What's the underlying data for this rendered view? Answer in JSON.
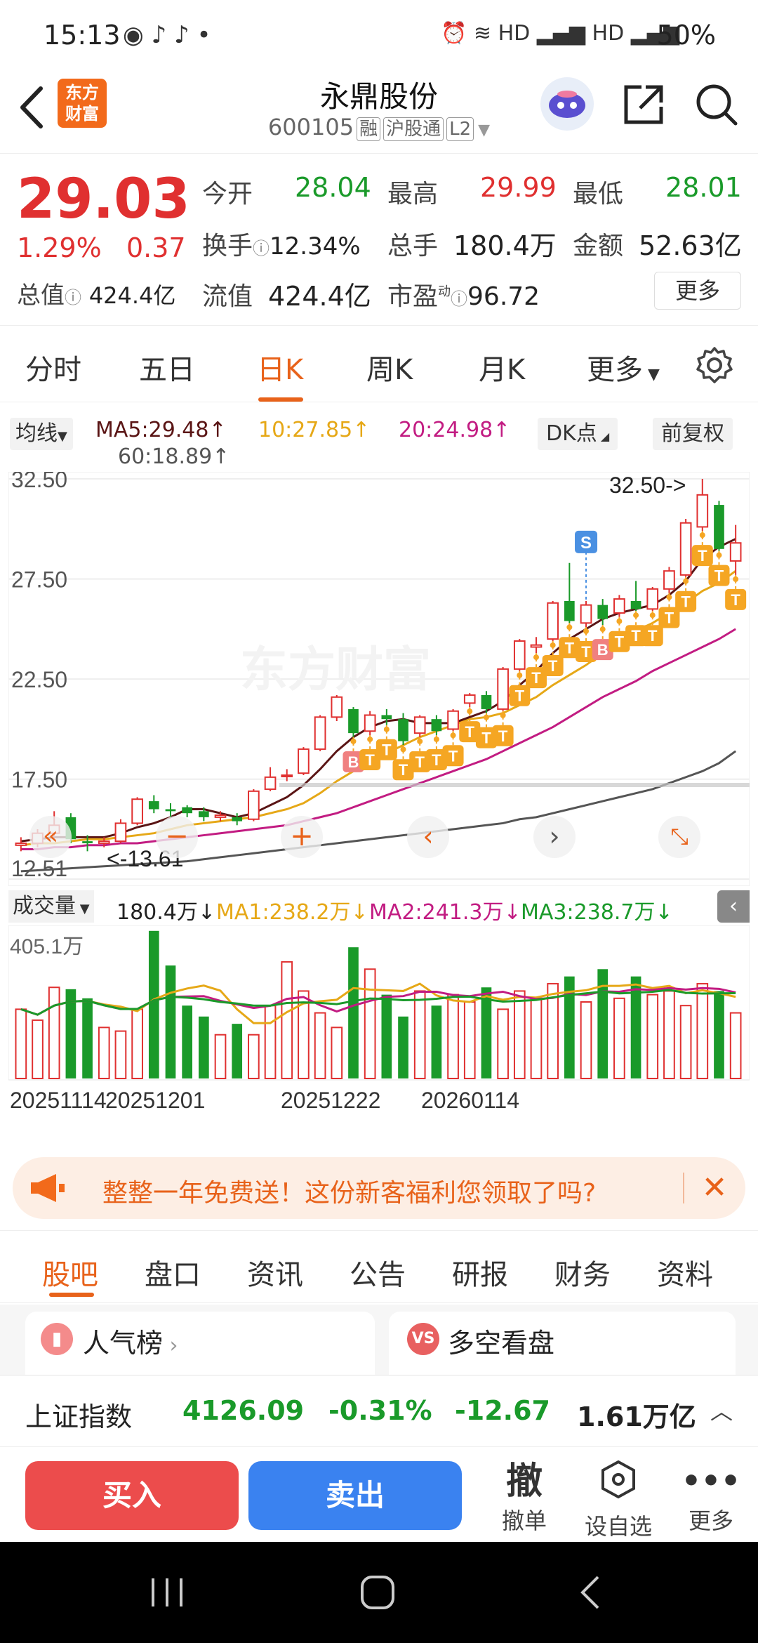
{
  "status": {
    "time": "15:13",
    "battery": "50%"
  },
  "header": {
    "logo_line1": "东方",
    "logo_line2": "财富",
    "title": "永鼎股份",
    "code": "600105",
    "tags": [
      "融",
      "沪股通",
      "L2"
    ]
  },
  "quote": {
    "price": "29.03",
    "change_pct": "1.29%",
    "change_amt": "0.37",
    "open_label": "今开",
    "open": "28.04",
    "high_label": "最高",
    "high": "29.99",
    "low_label": "最低",
    "low": "28.01",
    "turnover_label": "换手",
    "turnover": "12.34%",
    "volume_label": "总手",
    "volume": "180.4万",
    "amount_label": "金额",
    "amount": "52.63亿",
    "mktcap_label": "总值",
    "mktcap": "424.4亿",
    "float_label": "流值",
    "float": "424.4亿",
    "pe_label": "市盈",
    "pe_sup": "动",
    "pe": "96.72",
    "more": "更多"
  },
  "ktabs": [
    "分时",
    "五日",
    "日K",
    "周K",
    "月K",
    "更多"
  ],
  "ma": {
    "selector": "均线",
    "ma5": "MA5:29.48",
    "ma10": "10:27.85",
    "ma20": "20:24.98",
    "ma60": "60:18.89",
    "dk": "DK点",
    "adjust": "前复权"
  },
  "chart_data": {
    "type": "candlestick",
    "y_ticks": [
      "32.50",
      "27.50",
      "22.50",
      "17.50",
      "12.51"
    ],
    "ylim": [
      12.51,
      32.5
    ],
    "watermark": "东方财富",
    "max_label": "32.50->",
    "min_label": "<-13.61",
    "candles": [
      [
        14.2,
        14.3,
        14.6,
        13.9
      ],
      [
        14.3,
        14.8,
        15.0,
        14.1
      ],
      [
        14.8,
        15.2,
        15.9,
        14.6
      ],
      [
        15.6,
        14.5,
        15.8,
        14.3
      ],
      [
        14.4,
        14.3,
        14.7,
        13.9
      ],
      [
        14.3,
        14.4,
        14.6,
        14.1
      ],
      [
        14.4,
        15.3,
        15.5,
        14.3
      ],
      [
        15.3,
        16.5,
        16.6,
        15.2
      ],
      [
        16.4,
        16.0,
        16.7,
        15.8
      ],
      [
        16.0,
        15.9,
        16.3,
        15.6
      ],
      [
        16.1,
        15.8,
        16.2,
        15.6
      ],
      [
        15.9,
        15.6,
        16.1,
        15.4
      ],
      [
        15.6,
        15.7,
        15.9,
        15.4
      ],
      [
        15.6,
        15.4,
        15.8,
        15.2
      ],
      [
        15.5,
        16.9,
        17.0,
        15.4
      ],
      [
        17.0,
        17.6,
        18.1,
        16.9
      ],
      [
        17.7,
        17.7,
        18.0,
        17.4
      ],
      [
        17.8,
        19.0,
        19.1,
        17.7
      ],
      [
        19.0,
        20.6,
        20.7,
        18.9
      ],
      [
        20.6,
        21.6,
        21.7,
        20.4
      ],
      [
        21.0,
        19.8,
        21.1,
        19.6
      ],
      [
        19.9,
        20.7,
        20.9,
        19.7
      ],
      [
        20.7,
        20.5,
        21.0,
        20.2
      ],
      [
        20.5,
        19.4,
        20.8,
        19.2
      ],
      [
        19.8,
        20.6,
        20.7,
        19.6
      ],
      [
        20.5,
        19.9,
        20.7,
        19.7
      ],
      [
        20.0,
        20.9,
        21.0,
        19.9
      ],
      [
        21.3,
        21.7,
        21.8,
        21.1
      ],
      [
        21.7,
        21.0,
        21.9,
        20.8
      ],
      [
        21.0,
        23.0,
        23.1,
        20.9
      ],
      [
        23.0,
        24.4,
        24.5,
        22.9
      ],
      [
        24.1,
        24.2,
        24.6,
        23.8
      ],
      [
        24.5,
        26.3,
        26.4,
        24.4
      ],
      [
        26.4,
        25.4,
        28.3,
        25.3
      ],
      [
        25.3,
        26.2,
        26.4,
        25.1
      ],
      [
        26.2,
        25.5,
        26.5,
        25.2
      ],
      [
        25.8,
        26.5,
        26.7,
        25.6
      ],
      [
        26.4,
        26.0,
        27.4,
        25.9
      ],
      [
        26.0,
        27.0,
        27.1,
        25.9
      ],
      [
        27.0,
        27.9,
        28.1,
        26.8
      ],
      [
        27.7,
        30.3,
        30.5,
        27.6
      ],
      [
        30.1,
        31.7,
        32.5,
        29.9
      ],
      [
        31.2,
        29.0,
        31.4,
        28.9
      ],
      [
        28.4,
        29.3,
        30.2,
        27.7
      ]
    ],
    "markers": [
      {
        "i": 20,
        "label": "B"
      },
      {
        "i": 21,
        "label": "T"
      },
      {
        "i": 22,
        "label": "T"
      },
      {
        "i": 23,
        "label": "T"
      },
      {
        "i": 24,
        "label": "T"
      },
      {
        "i": 25,
        "label": "T"
      },
      {
        "i": 26,
        "label": "T"
      },
      {
        "i": 27,
        "label": "T"
      },
      {
        "i": 28,
        "label": "T"
      },
      {
        "i": 29,
        "label": "T"
      },
      {
        "i": 30,
        "label": "T"
      },
      {
        "i": 31,
        "label": "T"
      },
      {
        "i": 32,
        "label": "T"
      },
      {
        "i": 33,
        "label": "T"
      },
      {
        "i": 34,
        "label": "T"
      },
      {
        "i": 35,
        "label": "B"
      },
      {
        "i": 36,
        "label": "T"
      },
      {
        "i": 37,
        "label": "T"
      },
      {
        "i": 38,
        "label": "T"
      },
      {
        "i": 39,
        "label": "T"
      },
      {
        "i": 40,
        "label": "T"
      },
      {
        "i": 41,
        "label": "T"
      },
      {
        "i": 42,
        "label": "T"
      },
      {
        "i": 43,
        "label": "T"
      },
      {
        "i": 34,
        "label": "S",
        "top": true
      }
    ],
    "ma5": [
      14.4,
      14.5,
      14.6,
      14.6,
      14.6,
      14.6,
      14.8,
      15.1,
      15.3,
      15.6,
      16.0,
      16.0,
      15.8,
      15.6,
      15.8,
      16.2,
      16.6,
      17.2,
      18.0,
      18.9,
      19.6,
      20.1,
      20.4,
      20.5,
      20.3,
      20.3,
      20.3,
      20.6,
      20.9,
      21.4,
      22.2,
      22.9,
      23.8,
      24.5,
      25.0,
      25.5,
      25.8,
      26.0,
      26.2,
      26.7,
      27.4,
      28.5,
      29.1,
      29.5
    ],
    "ma10": [
      14.2,
      14.3,
      14.3,
      14.4,
      14.5,
      14.5,
      14.6,
      14.7,
      14.8,
      15.0,
      15.2,
      15.3,
      15.4,
      15.5,
      15.6,
      15.8,
      16.0,
      16.3,
      16.8,
      17.4,
      17.9,
      18.4,
      18.8,
      19.2,
      19.6,
      19.9,
      20.2,
      20.5,
      20.6,
      20.8,
      21.2,
      21.6,
      22.2,
      22.7,
      23.2,
      23.8,
      24.3,
      24.9,
      25.3,
      25.8,
      26.3,
      26.9,
      27.3,
      27.9
    ],
    "ma20": [
      14.0,
      14.0,
      14.1,
      14.1,
      14.2,
      14.2,
      14.3,
      14.3,
      14.4,
      14.5,
      14.6,
      14.7,
      14.8,
      14.9,
      15.0,
      15.1,
      15.2,
      15.4,
      15.6,
      15.8,
      16.1,
      16.4,
      16.7,
      17.0,
      17.3,
      17.6,
      17.9,
      18.2,
      18.5,
      18.9,
      19.3,
      19.7,
      20.1,
      20.6,
      21.1,
      21.6,
      22.0,
      22.4,
      22.9,
      23.3,
      23.7,
      24.1,
      24.5,
      25.0
    ],
    "ma60": [
      12.9,
      12.95,
      13.0,
      13.05,
      13.1,
      13.15,
      13.2,
      13.25,
      13.3,
      13.35,
      13.4,
      13.5,
      13.6,
      13.7,
      13.8,
      13.9,
      14.0,
      14.1,
      14.2,
      14.3,
      14.4,
      14.5,
      14.6,
      14.7,
      14.8,
      14.9,
      15.0,
      15.1,
      15.2,
      15.3,
      15.5,
      15.6,
      15.8,
      16.0,
      16.2,
      16.4,
      16.6,
      16.8,
      17.0,
      17.3,
      17.6,
      17.9,
      18.3,
      18.9
    ],
    "volume": {
      "selector": "成交量",
      "value": "180.4万",
      "ma1": "MA1:238.2万",
      "ma2": "MA2:241.3万",
      "ma3": "MA3:238.7万",
      "max_label": "405.1万",
      "bars": [
        190,
        160,
        250,
        245,
        220,
        140,
        130,
        190,
        405,
        310,
        200,
        170,
        120,
        150,
        120,
        200,
        320,
        240,
        180,
        140,
        360,
        300,
        230,
        170,
        240,
        200,
        230,
        210,
        250,
        190,
        240,
        220,
        260,
        280,
        210,
        300,
        220,
        280,
        230,
        240,
        200,
        260,
        240,
        180
      ]
    },
    "x_labels": [
      "20251114",
      "20251201",
      "20251222",
      "20260114"
    ]
  },
  "promo": {
    "text": "整整一年免费送！这份新客福利您领取了吗?"
  },
  "btabs": [
    "股吧",
    "盘口",
    "资讯",
    "公告",
    "研报",
    "财务",
    "资料"
  ],
  "cards": {
    "left": "人气榜",
    "right": "多空看盘"
  },
  "index": {
    "name": "上证指数",
    "value": "4126.09",
    "pct": "-0.31%",
    "chg": "-12.67",
    "amount": "1.61万亿"
  },
  "actions": {
    "buy": "买入",
    "sell": "卖出",
    "cancel_icon": "撤",
    "cancel": "撤单",
    "watch": "设自选",
    "more": "更多"
  },
  "colors": {
    "up": "#e03030",
    "down": "#1a9a2a",
    "accent": "#e8621a",
    "ma5": "#5a1515",
    "ma10": "#e6a817",
    "ma20": "#c21c82",
    "ma60": "#555555"
  }
}
